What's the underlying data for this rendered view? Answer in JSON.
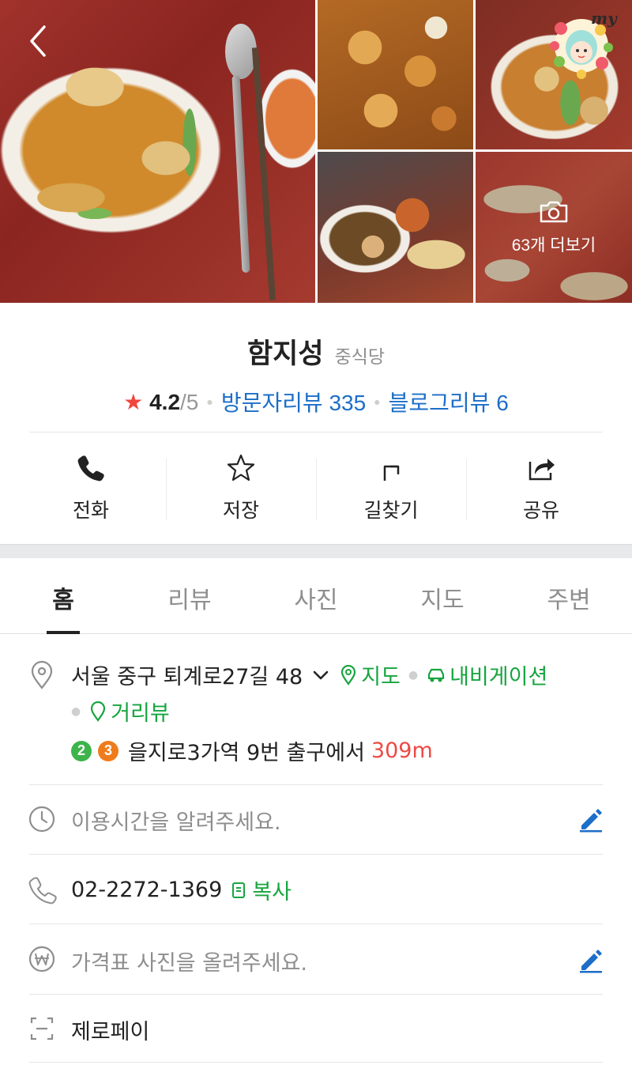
{
  "gallery": {
    "more_photos_label": "63개 더보기",
    "badge_text": "my"
  },
  "place": {
    "name": "함지성",
    "category": "중식당",
    "rating_star": "★",
    "rating": "4.2",
    "rating_max": "/5",
    "visitor_review_label": "방문자리뷰 335",
    "blog_review_label": "블로그리뷰 6"
  },
  "actions": [
    {
      "label": "전화",
      "icon": "phone-icon"
    },
    {
      "label": "저장",
      "icon": "star-icon"
    },
    {
      "label": "길찾기",
      "icon": "directions-icon"
    },
    {
      "label": "공유",
      "icon": "share-icon"
    }
  ],
  "tabs": [
    {
      "label": "홈",
      "active": true
    },
    {
      "label": "리뷰",
      "active": false
    },
    {
      "label": "사진",
      "active": false
    },
    {
      "label": "지도",
      "active": false
    },
    {
      "label": "주변",
      "active": false
    }
  ],
  "info": {
    "address": "서울 중구 퇴계로27길 48",
    "map_link": "지도",
    "navigation_link": "내비게이션",
    "street_view_link": "거리뷰",
    "subway_lines": [
      {
        "number": "2",
        "color": "#3cb44a"
      },
      {
        "number": "3",
        "color": "#ef7c1c"
      }
    ],
    "subway_text": "을지로3가역 9번 출구에서",
    "subway_distance": "309m",
    "hours_placeholder": "이용시간을 알려주세요.",
    "phone": "02-2272-1369",
    "copy_label": "복사",
    "price_placeholder": "가격표 사진을 올려주세요.",
    "zeropay_label": "제로페이"
  },
  "colors": {
    "accent_blue": "#1c6ec8",
    "accent_green": "#17a53f",
    "star_red": "#f0473f",
    "distance_red": "#ec4a45"
  }
}
